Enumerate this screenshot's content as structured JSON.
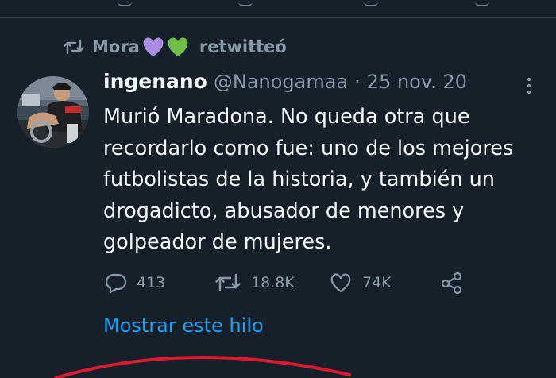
{
  "retweet": {
    "user": "Mora",
    "hearts": [
      "purple-heart",
      "green-heart"
    ],
    "label": "retwitteó"
  },
  "tweet": {
    "display_name": "ingenano",
    "handle": "@Nanogamaa",
    "separator": "·",
    "date": "25 nov. 20",
    "text_lines": [
      "Murió Maradona. No queda otra que",
      "recordarlo como fue: uno de los mejores",
      "futbolistas de la historia, y también un",
      "drogadicto, abusador de menores y",
      "golpeador de mujeres."
    ],
    "actions": {
      "replies": "413",
      "retweets": "18.8K",
      "likes": "74K"
    },
    "show_thread": "Mostrar este hilo"
  },
  "colors": {
    "background": "#15202b",
    "text": "#f5f8fa",
    "muted": "#8899a6",
    "link": "#1da1f2",
    "annotation": "#e0182d"
  }
}
